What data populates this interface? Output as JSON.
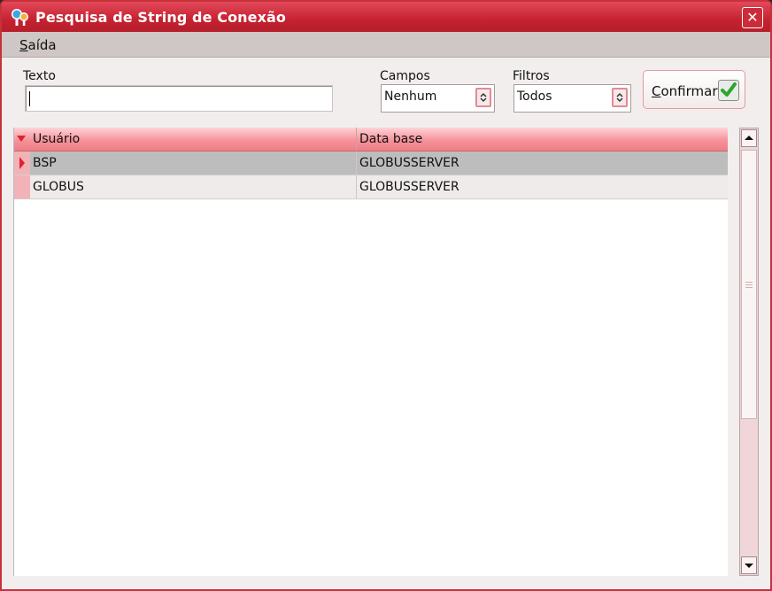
{
  "window": {
    "title": "Pesquisa de String de Conexão"
  },
  "menu": {
    "items": [
      {
        "label_ul": "S",
        "label_rest": "aída"
      }
    ]
  },
  "filters": {
    "texto_label": "Texto",
    "texto_value": "",
    "campos_label": "Campos",
    "campos_value": "Nenhum",
    "filtros_label": "Filtros",
    "filtros_value": "Todos"
  },
  "confirm": {
    "label_ul": "C",
    "label_rest": "onfirmar"
  },
  "grid": {
    "columns": [
      "Usuário",
      "Data base"
    ],
    "rows": [
      {
        "usuario": "BSP",
        "database": "GLOBUSSERVER",
        "selected": true
      },
      {
        "usuario": "GLOBUS",
        "database": "GLOBUSSERVER",
        "selected": false
      }
    ]
  },
  "colors": {
    "titlebar": "#c52231",
    "accent": "#e2495a",
    "selected_row": "#bdbdbd",
    "indicator": "#e0222e"
  }
}
